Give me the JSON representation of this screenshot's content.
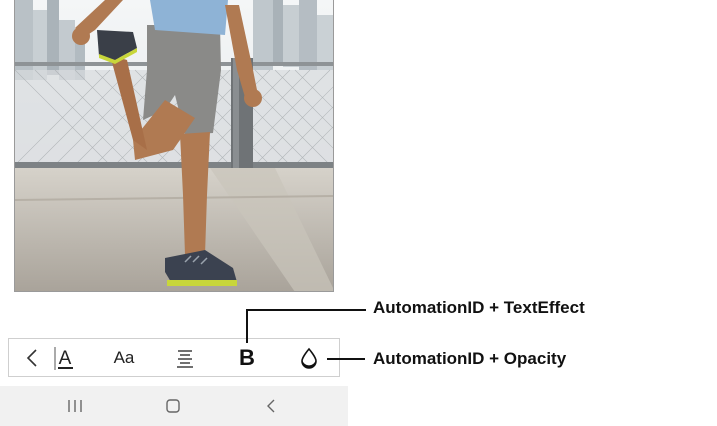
{
  "toolbar": {
    "items": [
      {
        "name": "back",
        "icon": "chevron-left-icon"
      },
      {
        "name": "text-color",
        "icon": "text-color-icon",
        "label": "A"
      },
      {
        "name": "font-size",
        "icon": "font-size-icon",
        "label": "Aa"
      },
      {
        "name": "alignment",
        "icon": "align-justify-icon"
      },
      {
        "name": "text-effect",
        "icon": "bold-icon",
        "label": "B"
      },
      {
        "name": "opacity",
        "icon": "opacity-drop-icon"
      }
    ]
  },
  "system_nav": {
    "items": [
      {
        "name": "recents",
        "icon": "recents-icon",
        "label": "III"
      },
      {
        "name": "home",
        "icon": "home-icon"
      },
      {
        "name": "back",
        "icon": "back-chevron-icon"
      }
    ]
  },
  "callouts": {
    "text_effect": "AutomationID + TextEffect",
    "opacity": "AutomationID + Opacity"
  },
  "colors": {
    "toolbar_border": "#cfcfcf",
    "navbar_bg": "#f1f1f1",
    "callout_text": "#111111"
  }
}
